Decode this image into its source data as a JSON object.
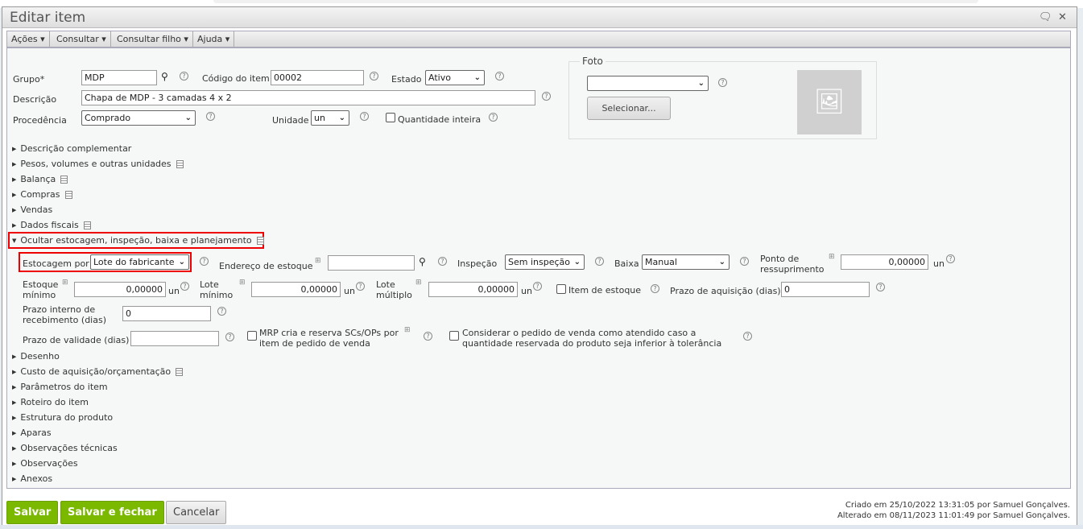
{
  "window": {
    "title": "Editar item"
  },
  "menus": [
    "Ações",
    "Consultar",
    "Consultar filho",
    "Ajuda"
  ],
  "form": {
    "grupo_label": "Grupo*",
    "grupo_value": "MDP",
    "codigo_label": "Código do item",
    "codigo_value": "00002",
    "estado_label": "Estado",
    "estado_value": "Ativo",
    "descricao_label": "Descrição",
    "descricao_value": "Chapa de MDP - 3 camadas 4 x 2",
    "procedencia_label": "Procedência",
    "procedencia_value": "Comprado",
    "unidade_label": "Unidade",
    "unidade_value": "un",
    "quantidade_inteira_label": "Quantidade inteira"
  },
  "foto": {
    "legend": "Foto",
    "select_value": "",
    "select_button": "Selecionar..."
  },
  "sections_before": [
    "Descrição complementar",
    "Pesos, volumes e outras unidades",
    "Balança",
    "Compras",
    "Vendas",
    "Dados fiscais"
  ],
  "expanded_section": "Ocultar estocagem, inspeção, baixa e planejamento",
  "estoque": {
    "estocagem_label": "Estocagem por",
    "estocagem_value": "Lote do fabricante",
    "endereco_label": "Endereço de estoque",
    "endereco_value": "",
    "inspecao_label": "Inspeção",
    "inspecao_value": "Sem inspeção",
    "baixa_label": "Baixa",
    "baixa_value": "Manual",
    "ponto_label1": "Ponto de",
    "ponto_label2": "ressuprimento",
    "ponto_value": "0,00000",
    "estoque_min_label1": "Estoque",
    "estoque_min_label2": "mínimo",
    "estoque_min_value": "0,00000",
    "lote_min_label1": "Lote",
    "lote_min_label2": "mínimo",
    "lote_min_value": "0,00000",
    "lote_mult_label1": "Lote",
    "lote_mult_label2": "múltiplo",
    "lote_mult_value": "0,00000",
    "unit": "un",
    "item_estoque_label": "Item de estoque",
    "prazo_aquisicao_label": "Prazo de aquisição (dias)",
    "prazo_aquisicao_value": "0",
    "prazo_interno_label1": "Prazo interno de",
    "prazo_interno_label2": "recebimento (dias)",
    "prazo_interno_value": "0",
    "prazo_validade_label": "Prazo de validade (dias)",
    "prazo_validade_value": "",
    "mrp_label1": "MRP cria e reserva SCs/OPs por",
    "mrp_label2": "item de pedido de venda",
    "considerar_label1": "Considerar o pedido de venda como atendido caso a",
    "considerar_label2": "quantidade reservada do produto seja inferior à tolerância"
  },
  "sections_after": [
    "Desenho",
    "Custo de aquisição/orçamentação",
    "Parâmetros do item",
    "Roteiro do item",
    "Estrutura do produto",
    "Aparas",
    "Observações técnicas",
    "Observações",
    "Anexos"
  ],
  "footer": {
    "salvar": "Salvar",
    "salvar_fechar": "Salvar e fechar",
    "cancelar": "Cancelar",
    "criado": "Criado em 25/10/2022 13:31:05 por Samuel Gonçalves.",
    "alterado": "Alterado em 08/11/2023 11:01:49 por Samuel Gonçalves."
  }
}
